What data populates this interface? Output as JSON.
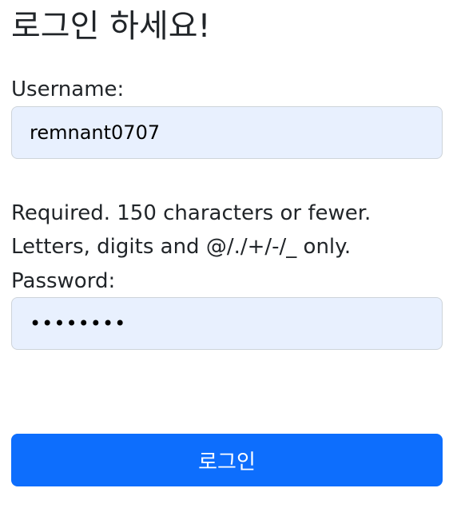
{
  "page": {
    "title": "로그인 하세요!"
  },
  "form": {
    "username_label": "Username:",
    "username_value": "remnant0707",
    "help_text": [
      "Required. 150 characters or fewer.",
      "Letters, digits and @/./+/-/_ only."
    ],
    "password_label": "Password:",
    "password_value": "password",
    "submit_label": "로그인"
  },
  "colors": {
    "input_background": "#e8f0fe",
    "submit_background": "#0d6efd",
    "submit_text": "#ffffff"
  }
}
